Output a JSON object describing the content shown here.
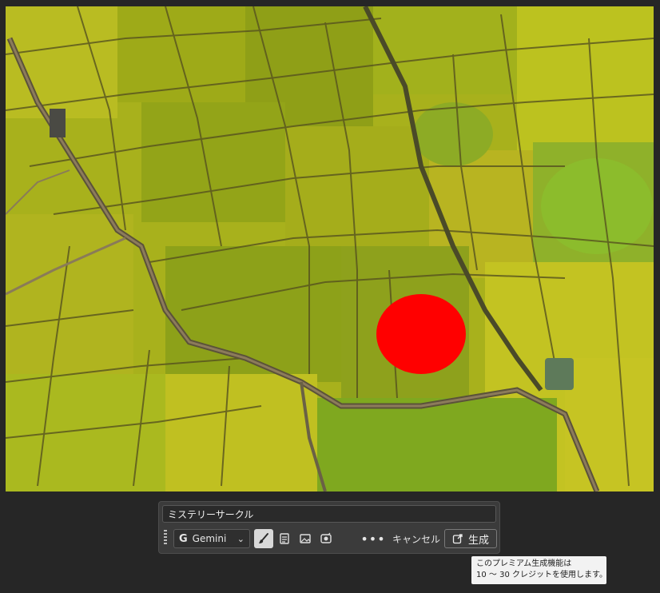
{
  "canvas": {
    "description_colors": {
      "field_yellow": "#b5b81f",
      "field_green": "#8aa019",
      "dike": "#4e4a24",
      "path": "#8f7d58",
      "red_mark": "#ff0000"
    }
  },
  "prompt": {
    "value": "ミステリーサークル"
  },
  "toolbar": {
    "model_label": "Gemini",
    "model_icon": "G",
    "icons": [
      "brush-icon",
      "document-icon",
      "image-icon",
      "style-icon"
    ],
    "more_label": "•••",
    "cancel_label": "キャンセル",
    "generate_label": "生成"
  },
  "tooltip": {
    "line1": "このプレミアム生成機能は",
    "line2": "10 〜 30 クレジットを使用します。"
  }
}
